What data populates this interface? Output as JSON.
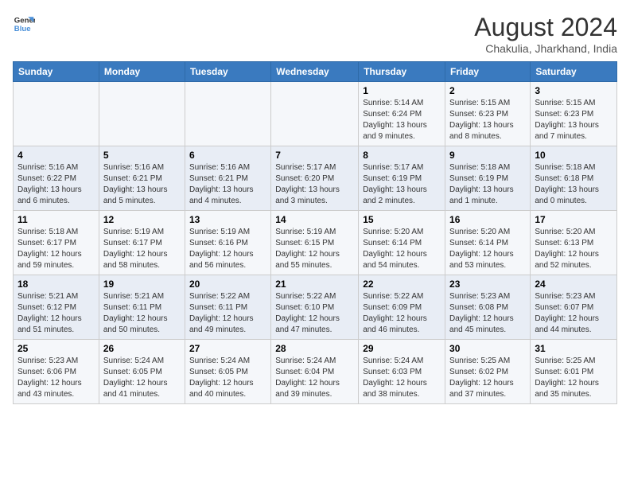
{
  "logo": {
    "line1": "General",
    "line2": "Blue"
  },
  "title": "August 2024",
  "subtitle": "Chakulia, Jharkhand, India",
  "days_of_week": [
    "Sunday",
    "Monday",
    "Tuesday",
    "Wednesday",
    "Thursday",
    "Friday",
    "Saturday"
  ],
  "weeks": [
    [
      {
        "num": "",
        "detail": ""
      },
      {
        "num": "",
        "detail": ""
      },
      {
        "num": "",
        "detail": ""
      },
      {
        "num": "",
        "detail": ""
      },
      {
        "num": "1",
        "detail": "Sunrise: 5:14 AM\nSunset: 6:24 PM\nDaylight: 13 hours\nand 9 minutes."
      },
      {
        "num": "2",
        "detail": "Sunrise: 5:15 AM\nSunset: 6:23 PM\nDaylight: 13 hours\nand 8 minutes."
      },
      {
        "num": "3",
        "detail": "Sunrise: 5:15 AM\nSunset: 6:23 PM\nDaylight: 13 hours\nand 7 minutes."
      }
    ],
    [
      {
        "num": "4",
        "detail": "Sunrise: 5:16 AM\nSunset: 6:22 PM\nDaylight: 13 hours\nand 6 minutes."
      },
      {
        "num": "5",
        "detail": "Sunrise: 5:16 AM\nSunset: 6:21 PM\nDaylight: 13 hours\nand 5 minutes."
      },
      {
        "num": "6",
        "detail": "Sunrise: 5:16 AM\nSunset: 6:21 PM\nDaylight: 13 hours\nand 4 minutes."
      },
      {
        "num": "7",
        "detail": "Sunrise: 5:17 AM\nSunset: 6:20 PM\nDaylight: 13 hours\nand 3 minutes."
      },
      {
        "num": "8",
        "detail": "Sunrise: 5:17 AM\nSunset: 6:19 PM\nDaylight: 13 hours\nand 2 minutes."
      },
      {
        "num": "9",
        "detail": "Sunrise: 5:18 AM\nSunset: 6:19 PM\nDaylight: 13 hours\nand 1 minute."
      },
      {
        "num": "10",
        "detail": "Sunrise: 5:18 AM\nSunset: 6:18 PM\nDaylight: 13 hours\nand 0 minutes."
      }
    ],
    [
      {
        "num": "11",
        "detail": "Sunrise: 5:18 AM\nSunset: 6:17 PM\nDaylight: 12 hours\nand 59 minutes."
      },
      {
        "num": "12",
        "detail": "Sunrise: 5:19 AM\nSunset: 6:17 PM\nDaylight: 12 hours\nand 58 minutes."
      },
      {
        "num": "13",
        "detail": "Sunrise: 5:19 AM\nSunset: 6:16 PM\nDaylight: 12 hours\nand 56 minutes."
      },
      {
        "num": "14",
        "detail": "Sunrise: 5:19 AM\nSunset: 6:15 PM\nDaylight: 12 hours\nand 55 minutes."
      },
      {
        "num": "15",
        "detail": "Sunrise: 5:20 AM\nSunset: 6:14 PM\nDaylight: 12 hours\nand 54 minutes."
      },
      {
        "num": "16",
        "detail": "Sunrise: 5:20 AM\nSunset: 6:14 PM\nDaylight: 12 hours\nand 53 minutes."
      },
      {
        "num": "17",
        "detail": "Sunrise: 5:20 AM\nSunset: 6:13 PM\nDaylight: 12 hours\nand 52 minutes."
      }
    ],
    [
      {
        "num": "18",
        "detail": "Sunrise: 5:21 AM\nSunset: 6:12 PM\nDaylight: 12 hours\nand 51 minutes."
      },
      {
        "num": "19",
        "detail": "Sunrise: 5:21 AM\nSunset: 6:11 PM\nDaylight: 12 hours\nand 50 minutes."
      },
      {
        "num": "20",
        "detail": "Sunrise: 5:22 AM\nSunset: 6:11 PM\nDaylight: 12 hours\nand 49 minutes."
      },
      {
        "num": "21",
        "detail": "Sunrise: 5:22 AM\nSunset: 6:10 PM\nDaylight: 12 hours\nand 47 minutes."
      },
      {
        "num": "22",
        "detail": "Sunrise: 5:22 AM\nSunset: 6:09 PM\nDaylight: 12 hours\nand 46 minutes."
      },
      {
        "num": "23",
        "detail": "Sunrise: 5:23 AM\nSunset: 6:08 PM\nDaylight: 12 hours\nand 45 minutes."
      },
      {
        "num": "24",
        "detail": "Sunrise: 5:23 AM\nSunset: 6:07 PM\nDaylight: 12 hours\nand 44 minutes."
      }
    ],
    [
      {
        "num": "25",
        "detail": "Sunrise: 5:23 AM\nSunset: 6:06 PM\nDaylight: 12 hours\nand 43 minutes."
      },
      {
        "num": "26",
        "detail": "Sunrise: 5:24 AM\nSunset: 6:05 PM\nDaylight: 12 hours\nand 41 minutes."
      },
      {
        "num": "27",
        "detail": "Sunrise: 5:24 AM\nSunset: 6:05 PM\nDaylight: 12 hours\nand 40 minutes."
      },
      {
        "num": "28",
        "detail": "Sunrise: 5:24 AM\nSunset: 6:04 PM\nDaylight: 12 hours\nand 39 minutes."
      },
      {
        "num": "29",
        "detail": "Sunrise: 5:24 AM\nSunset: 6:03 PM\nDaylight: 12 hours\nand 38 minutes."
      },
      {
        "num": "30",
        "detail": "Sunrise: 5:25 AM\nSunset: 6:02 PM\nDaylight: 12 hours\nand 37 minutes."
      },
      {
        "num": "31",
        "detail": "Sunrise: 5:25 AM\nSunset: 6:01 PM\nDaylight: 12 hours\nand 35 minutes."
      }
    ]
  ]
}
